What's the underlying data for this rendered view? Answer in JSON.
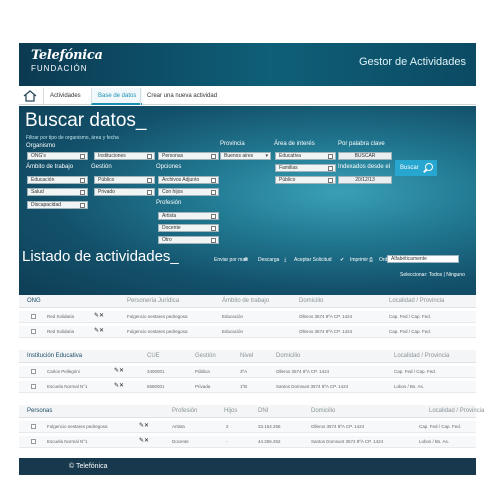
{
  "header": {
    "brand": "Telefónica",
    "subbrand": "FUNDACIÓN",
    "app_title": "Gestor de Actividades"
  },
  "nav": {
    "tabs": [
      "Actividades",
      "Base de datos",
      "Crear una nueva actividad"
    ]
  },
  "search": {
    "title": "Buscar datos_",
    "hint": "Filtrar por tipo de organismo, área y fecha",
    "organismo_label": "Organismo",
    "organismo": [
      "ONG's",
      "Instituciones",
      "Personas"
    ],
    "ambito_label": "Ámbito de trabajo",
    "ambito": [
      "Educación",
      "Salud",
      "Discapacidad"
    ],
    "gestion_label": "Gestión",
    "gestion": [
      "Público",
      "Privado"
    ],
    "opciones_label": "Opciones",
    "opciones": [
      "Archivos Adjunto",
      "Con hijos"
    ],
    "profesion_label": "Profesión",
    "profesion": [
      "Artista",
      "Docente",
      "Otro"
    ],
    "provincia_label": "Provincia",
    "provincia_value": "Buenos aires",
    "area_label": "Área de interés",
    "area": [
      "Educativa",
      "Familias",
      "Público"
    ],
    "clave_label": "Por palabra clave",
    "clave_value": "BUSCAR",
    "indexados_label": "Indexados desde el",
    "indexados_value": "20/12/13",
    "buscar_button": "Buscar"
  },
  "listado": {
    "title": "Listado de actividades_",
    "enviar": "Enviar por mail",
    "descarga": "Descarga",
    "aceptar": "Aceptar Solicitud",
    "imprimir": "Imprimir",
    "ordenar": "Ordenar por",
    "ordenar_value": "Alfabéticamente",
    "seleccionar": "Seleccionar:  Todos  |  Ninguno"
  },
  "ong": {
    "headers": [
      "ONG",
      "Personería Jurídica",
      "Ámbito de trabajo",
      "Domicilio",
      "Localidad / Provincia"
    ],
    "rows": [
      [
        "Red Solidaria",
        "Fulgencio nestares pedregosa",
        "Educación",
        "Olleros 3574 8ºA CP. 1424",
        "Cap. Fed / Cap. Fed."
      ],
      [
        "Red Solidaria",
        "Fulgencio nestares pedregosa",
        "Educación",
        "Olleros 3574 8ºA CP. 1424",
        "Cap. Fed / Cap. Fed."
      ]
    ]
  },
  "inst": {
    "headers": [
      "Institución Educativa",
      "CUE",
      "Gestión",
      "Nivel",
      "Domicilio",
      "Localidad / Provincia"
    ],
    "rows": [
      [
        "Carlos Pellegrini",
        "3400001",
        "Pública",
        "3ºA",
        "Olleros 3574 8ºA CP. 1424",
        "Cap. Fed / Cap. Fed."
      ],
      [
        "Escuela Normal N°1",
        "6580001",
        "Privada",
        "1ºB",
        "Santos Domsunt 3574 8ºA CP. 1424",
        "Lobos / Bs. As."
      ]
    ]
  },
  "personas": {
    "headers": [
      "Personas",
      "Profesión",
      "Hijos",
      "DNI",
      "Domicilio",
      "Localidad / Provincia"
    ],
    "rows": [
      [
        "Fulgencio nestares pedregosa",
        "Artista",
        "2",
        "33.154.256",
        "Olleros 3574 8ºA CP. 1424",
        "Cap. Fed / Cap. Fed."
      ],
      [
        "Escuela Normal N°1",
        "Docente",
        "-",
        "44.256.262",
        "Santos Domsunt 3574 8ºA CP. 1424",
        "Lobos / Bs. As."
      ]
    ]
  },
  "footer": {
    "text": "© Telefónica"
  }
}
